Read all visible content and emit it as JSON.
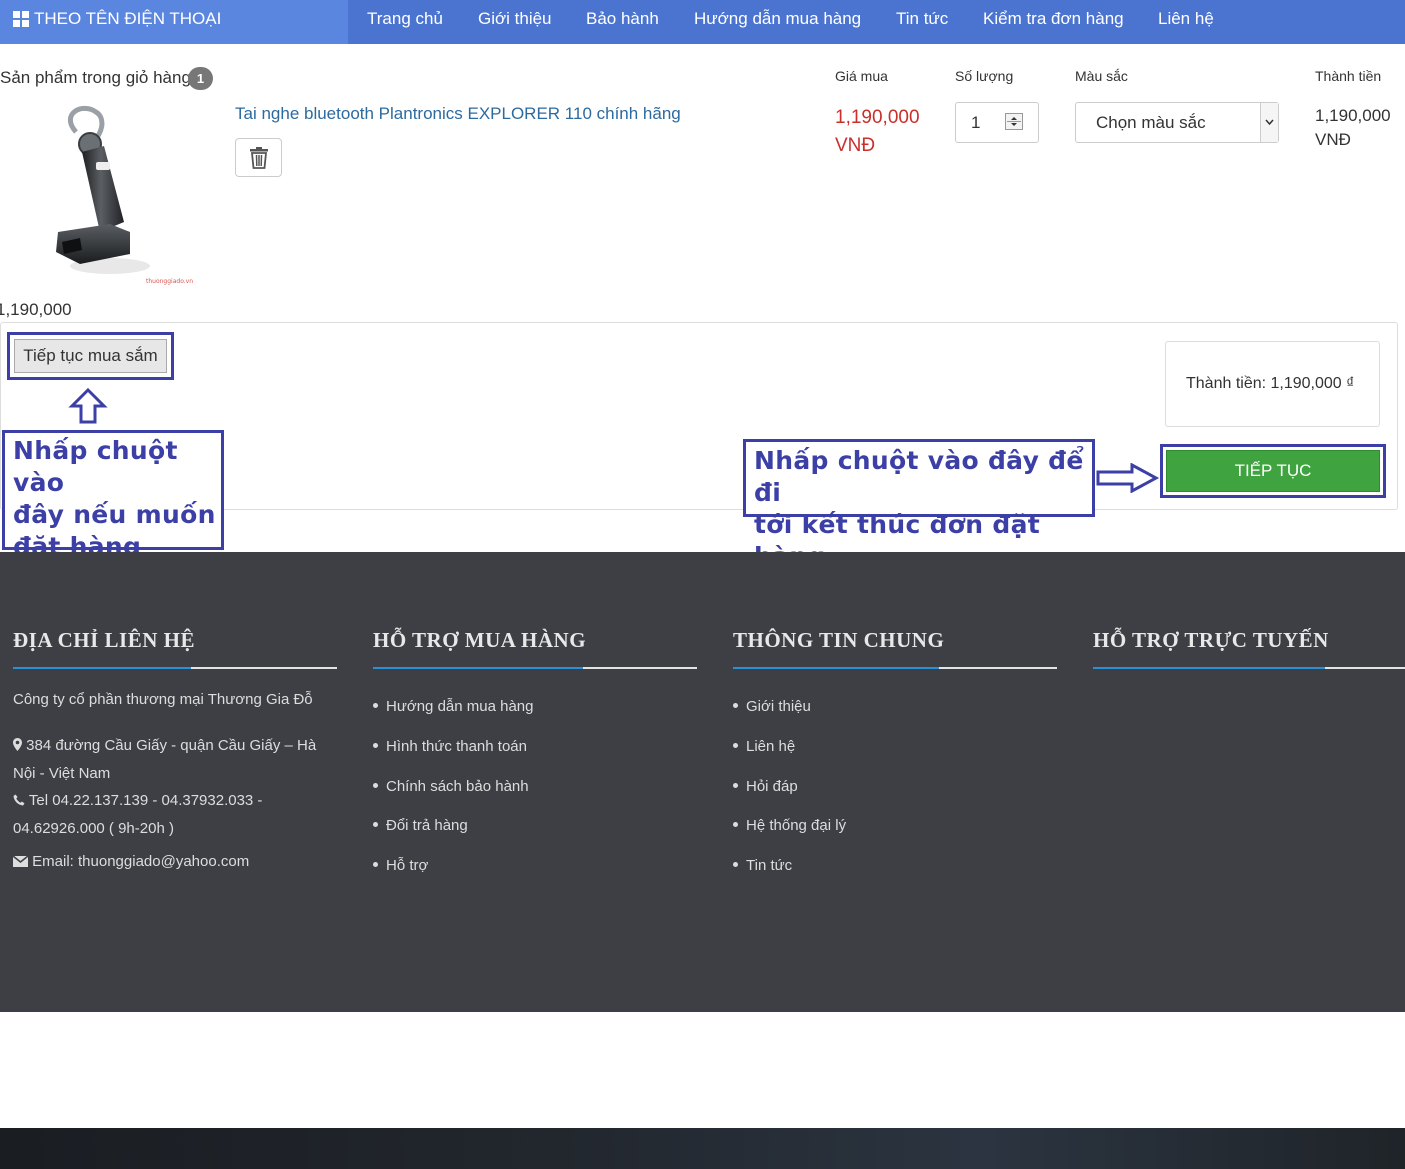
{
  "nav": {
    "category_label": "THEO TÊN ĐIỆN THOẠI",
    "items": [
      "Trang chủ",
      "Giới thiệu",
      "Bảo hành",
      "Hướng dẫn mua hàng",
      "Tin tức",
      "Kiểm tra đơn hàng",
      "Liên hệ"
    ]
  },
  "cart": {
    "title": "Sản phẩm trong giỏ hàng",
    "count": "1",
    "columns": {
      "price": "Giá mua",
      "quantity": "Số lượng",
      "color": "Màu sắc",
      "subtotal": "Thành tiền"
    },
    "product": {
      "name": "Tai nghe bluetooth Plantronics EXPLORER 110 chính hãng",
      "price_line1": "1,190,000",
      "price_line2": "VNĐ",
      "quantity": "1",
      "color_placeholder": "Chọn màu sắc",
      "subtotal_line1": "1,190,000",
      "subtotal_line2": "VNĐ",
      "image_watermark": "thuonggiado.vn",
      "below_image_price": "1,190,000"
    },
    "continue_label": "Tiếp tục mua sắm",
    "total_text": "Thành tiền: 1,190,000 ₫",
    "next_label": "TIẾP TỤC"
  },
  "annotations": {
    "left_lines": [
      "Nhấp chuột vào",
      "đây nếu muốn",
      "đặt hàng thêm"
    ],
    "right_lines": [
      "Nhấp chuột vào đây để đi",
      "tới kết thúc đơn đặt hàng"
    ]
  },
  "footer": {
    "headings": [
      "ĐỊA CHỈ LIÊN HỆ",
      "HỖ TRỢ MUA HÀNG",
      "THÔNG TIN CHUNG",
      "HỖ TRỢ TRỰC TUYẾN"
    ],
    "company": "Công ty cổ phần thương mại Thương Gia Đỗ",
    "address_line1": "384 đường Cầu Giấy - quận Cầu Giấy – Hà",
    "address_line2": "Nội - Việt Nam",
    "tel_line1": "Tel 04.22.137.139 - 04.37932.033 -",
    "tel_line2": "04.62926.000 ( 9h-20h )",
    "email": "Email: thuonggiado@yahoo.com",
    "support_links": [
      "Hướng dẫn mua hàng",
      "Hình thức thanh toán",
      "Chính sách bảo hành",
      "Đổi trả hàng",
      "Hỗ trợ"
    ],
    "info_links": [
      "Giới thiệu",
      "Liên hệ",
      "Hỏi đáp",
      "Hệ thống đại lý",
      "Tin tức"
    ]
  },
  "colors": {
    "nav_bg": "#4b74d1",
    "price_red": "#c9302c",
    "link_blue": "#2c6aa0",
    "green_button": "#3fa43f",
    "annotation_blue": "#3b3fa6",
    "footer_bg": "#3d3f45"
  }
}
